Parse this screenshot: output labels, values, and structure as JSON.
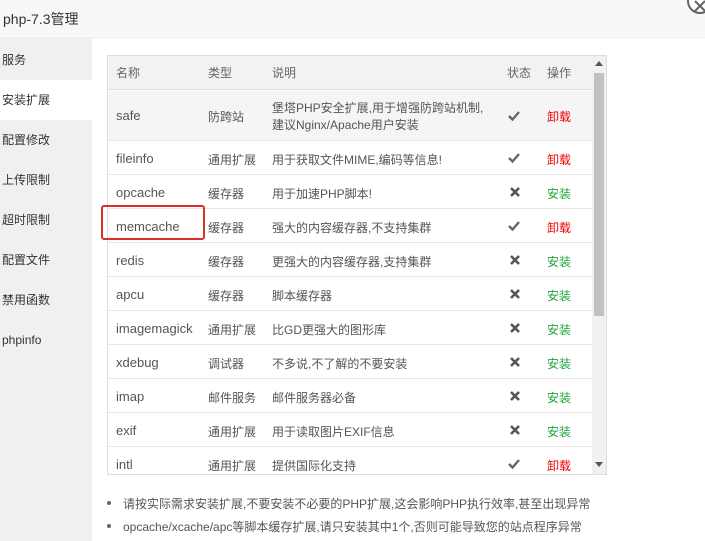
{
  "window": {
    "title": "php-7.3管理"
  },
  "sidebar": {
    "items": [
      {
        "label": "服务"
      },
      {
        "label": "安装扩展"
      },
      {
        "label": "配置修改"
      },
      {
        "label": "上传限制"
      },
      {
        "label": "超时限制"
      },
      {
        "label": "配置文件"
      },
      {
        "label": "禁用函数"
      },
      {
        "label": "phpinfo"
      }
    ],
    "active": "安装扩展"
  },
  "table": {
    "headers": {
      "name": "名称",
      "type": "类型",
      "desc": "说明",
      "status": "状态",
      "action": "操作"
    },
    "rows": [
      {
        "name": "safe",
        "type": "防跨站",
        "desc1": "堡塔PHP安全扩展,用于增强防跨站机制,",
        "desc2": "建议Nginx/Apache用户安装",
        "status": "installed",
        "action": "卸载"
      },
      {
        "name": "fileinfo",
        "type": "通用扩展",
        "desc1": "用于获取文件MIME,编码等信息!",
        "status": "installed",
        "action": "卸载"
      },
      {
        "name": "opcache",
        "type": "缓存器",
        "desc1": "用于加速PHP脚本!",
        "status": "not-installed",
        "action": "安装"
      },
      {
        "name": "memcache",
        "type": "缓存器",
        "desc1": "强大的内容缓存器,不支持集群",
        "status": "installed",
        "action": "卸载"
      },
      {
        "name": "redis",
        "type": "缓存器",
        "desc1": "更强大的内容缓存器,支持集群",
        "status": "not-installed",
        "action": "安装"
      },
      {
        "name": "apcu",
        "type": "缓存器",
        "desc1": "脚本缓存器",
        "status": "not-installed",
        "action": "安装"
      },
      {
        "name": "imagemagick",
        "type": "通用扩展",
        "desc1": "比GD更强大的图形库",
        "status": "not-installed",
        "action": "安装"
      },
      {
        "name": "xdebug",
        "type": "调试器",
        "desc1": "不多说,不了解的不要安装",
        "status": "not-installed",
        "action": "安装"
      },
      {
        "name": "imap",
        "type": "邮件服务",
        "desc1": "邮件服务器必备",
        "status": "not-installed",
        "action": "安装"
      },
      {
        "name": "exif",
        "type": "通用扩展",
        "desc1": "用于读取图片EXIF信息",
        "status": "not-installed",
        "action": "安装"
      },
      {
        "name": "intl",
        "type": "通用扩展",
        "desc1": "提供国际化支持",
        "status": "installed",
        "action": "卸载"
      }
    ]
  },
  "notes": [
    "请按实际需求安装扩展,不要安装不必要的PHP扩展,这会影响PHP执行效率,甚至出现异常",
    "opcache/xcache/apc等脚本缓存扩展,请只安装其中1个,否则可能导致您的站点程序异常"
  ],
  "colors": {
    "install": "#20a53a",
    "uninstall": "#e00000",
    "highlight": "#d9302b",
    "sidebar_bg": "#f0f0f0"
  },
  "icons": {
    "installed": "check-icon",
    "not_installed": "cross-icon",
    "close": "close-icon"
  }
}
